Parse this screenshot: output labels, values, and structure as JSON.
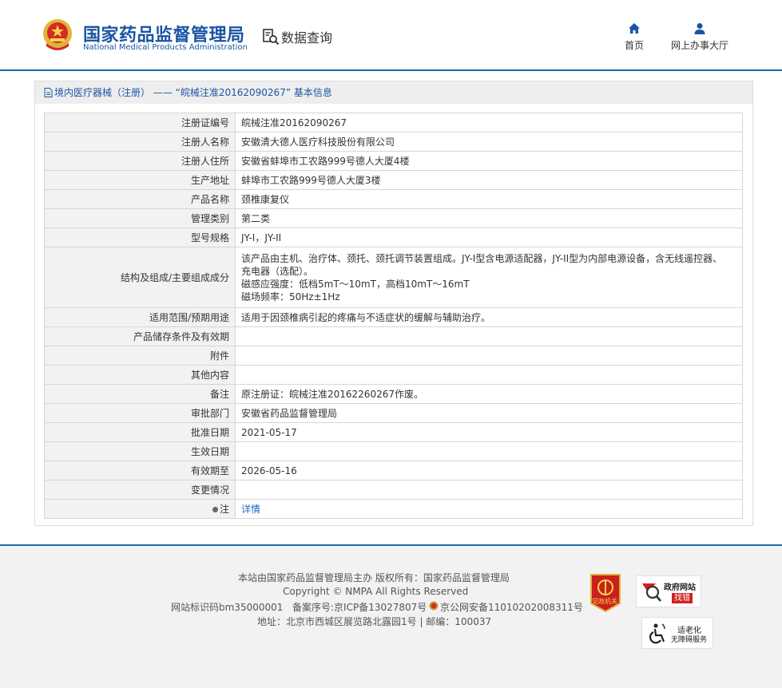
{
  "header": {
    "brand_cn": "国家药品监督管理局",
    "brand_en": "National Medical Products Administration",
    "search_title": "数据查询",
    "nav": [
      {
        "label": "首页",
        "icon": "home-icon"
      },
      {
        "label": "网上办事大厅",
        "icon": "user-icon"
      }
    ]
  },
  "breadcrumb": {
    "text": "境内医疗器械（注册） —— “皖械注准20162090267” 基本信息"
  },
  "fields": [
    {
      "label": "注册证编号",
      "value": "皖械注准20162090267"
    },
    {
      "label": "注册人名称",
      "value": "安徽清大德人医疗科技股份有限公司"
    },
    {
      "label": "注册人住所",
      "value": "安徽省蚌埠市工农路999号德人大厦4楼"
    },
    {
      "label": "生产地址",
      "value": "蚌埠市工农路999号德人大厦3楼"
    },
    {
      "label": "产品名称",
      "value": "颈椎康复仪"
    },
    {
      "label": "管理类别",
      "value": "第二类"
    },
    {
      "label": "型号规格",
      "value": "JY-I，JY-II"
    },
    {
      "label": "结构及组成/主要组成成分",
      "lines": [
        "该产品由主机、治疗体、颈托、颈托调节装置组成。JY-I型含电源适配器，JY-II型为内部电源设备，含无线遥控器、",
        "充电器（选配）。",
        "磁感应强度：低档5mT～10mT，高档10mT～16mT",
        "磁场频率：50Hz±1Hz"
      ]
    },
    {
      "label": "适用范围/预期用途",
      "value": "适用于因颈椎病引起的疼痛与不适症状的缓解与辅助治疗。"
    },
    {
      "label": "产品储存条件及有效期",
      "value": ""
    },
    {
      "label": "附件",
      "value": ""
    },
    {
      "label": "其他内容",
      "value": ""
    },
    {
      "label": "备注",
      "value": "原注册证：皖械注准20162260267作废。"
    },
    {
      "label": "审批部门",
      "value": "安徽省药品监督管理局"
    },
    {
      "label": "批准日期",
      "value": "2021-05-17"
    },
    {
      "label": "生效日期",
      "value": ""
    },
    {
      "label": "有效期至",
      "value": "2026-05-16"
    },
    {
      "label": "变更情况",
      "value": ""
    },
    {
      "label": "注",
      "value": "详情"
    }
  ],
  "footer": {
    "line1": "本站由国家药品监督管理局主办 版权所有：国家药品监督管理局",
    "line2": "Copyright © NMPA All Rights Reserved",
    "site_id": "网站标识码bm35000001",
    "icp": "备案序号:京ICP备13027807号",
    "police": "京公网安备11010202008311号",
    "address": "地址：北京市西城区展览路北露园1号 | 邮编：100037",
    "party_badge": "党政机关",
    "gov_badge_title": "政府网站",
    "gov_badge_action": "找错",
    "acc_badge_title": "适老化",
    "acc_badge_sub": "无障碍服务"
  },
  "colors": {
    "brand_blue": "#1a55a5",
    "header_rule": "#1c6ab0",
    "label_bg": "#f2f2f2",
    "link": "#1a6ac2"
  }
}
